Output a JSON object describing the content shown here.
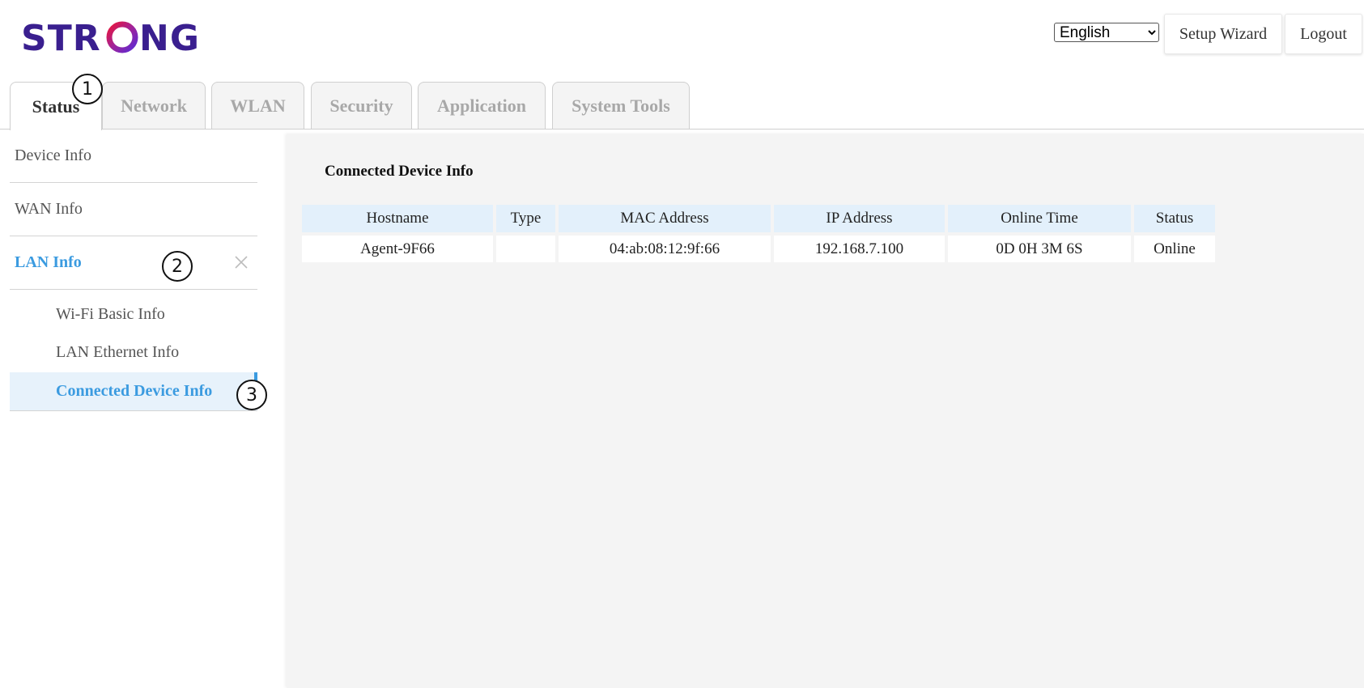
{
  "brand": {
    "logo_text": "STRONG"
  },
  "header": {
    "language": {
      "selected": "English",
      "options": [
        "English"
      ]
    },
    "setup_wizard_label": "Setup Wizard",
    "logout_label": "Logout"
  },
  "tabs": [
    {
      "label": "Status",
      "active": true
    },
    {
      "label": "Network",
      "active": false
    },
    {
      "label": "WLAN",
      "active": false
    },
    {
      "label": "Security",
      "active": false
    },
    {
      "label": "Application",
      "active": false
    },
    {
      "label": "System Tools",
      "active": false
    }
  ],
  "sidebar": {
    "items": [
      {
        "label": "Device Info"
      },
      {
        "label": "WAN Info"
      },
      {
        "label": "LAN Info",
        "active": true,
        "expanded": true
      }
    ],
    "sub_items": [
      {
        "label": "Wi-Fi Basic Info"
      },
      {
        "label": "LAN Ethernet Info"
      },
      {
        "label": "Connected Device Info",
        "active": true
      }
    ]
  },
  "callouts": [
    "1",
    "2",
    "3"
  ],
  "main": {
    "title": "Connected Device Info",
    "table": {
      "headers": [
        "Hostname",
        "Type",
        "MAC Address",
        "IP Address",
        "Online Time",
        "Status"
      ],
      "rows": [
        [
          "Agent-9F66",
          "",
          "04:ab:08:12:9f:66",
          "192.168.7.100",
          "0D 0H 3M 6S",
          "Online"
        ]
      ]
    }
  },
  "colors": {
    "accent": "#3b9be0",
    "logo_gradient": [
      "#e8153c",
      "#a1239a",
      "#5b2bd4"
    ],
    "logo_text": "#3a1f8f"
  }
}
